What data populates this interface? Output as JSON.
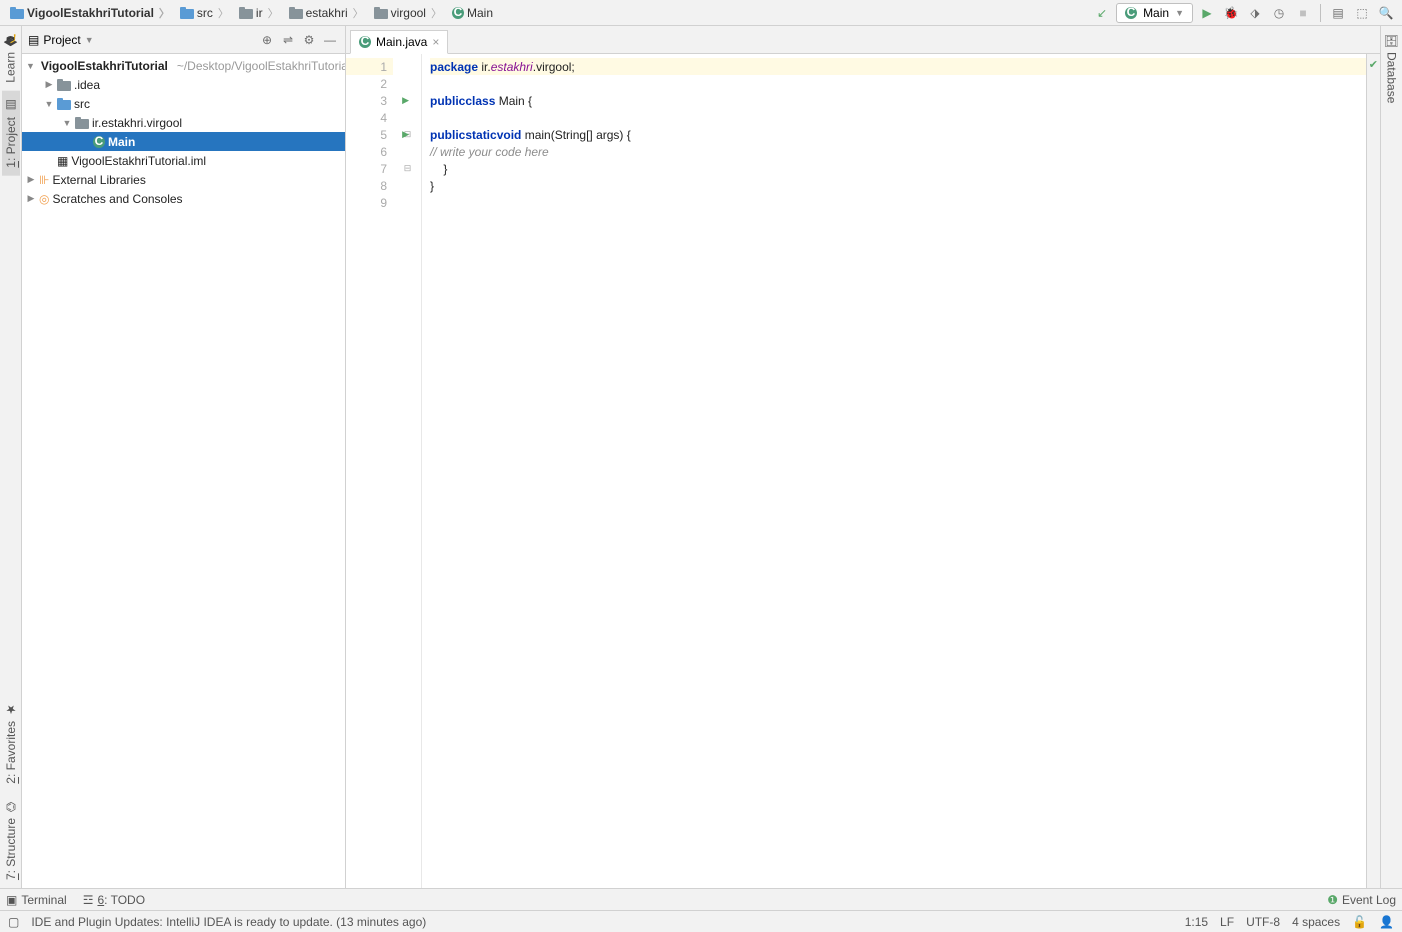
{
  "breadcrumb": [
    {
      "label": "VigoolEstakhriTutorial",
      "icon": "folder-blue",
      "bold": true
    },
    {
      "label": "src",
      "icon": "folder-blue"
    },
    {
      "label": "ir",
      "icon": "folder"
    },
    {
      "label": "estakhri",
      "icon": "folder"
    },
    {
      "label": "virgool",
      "icon": "folder"
    },
    {
      "label": "Main",
      "icon": "class"
    }
  ],
  "run_config": "Main",
  "panel": {
    "title": "Project"
  },
  "tree": {
    "root": "VigoolEstakhriTutorial",
    "root_hint": "~/Desktop/VigoolEstakhriTutorial",
    "idea": ".idea",
    "src": "src",
    "pkg": "ir.estakhri.virgool",
    "main": "Main",
    "iml": "VigoolEstakhriTutorial.iml",
    "ext": "External Libraries",
    "scratch": "Scratches and Consoles"
  },
  "tab": {
    "name": "Main.java"
  },
  "code": {
    "l1_kw": "package",
    "l1_rest": " ir.",
    "l1_pkg": "estakhri",
    "l1_rest2": ".virgool;",
    "l3_kw1": "public",
    "l3_kw2": "class",
    "l3_rest": " Main {",
    "l5_kw1": "public",
    "l5_kw2": "static",
    "l5_kw3": "void",
    "l5_rest": " main(String[] args) {",
    "l6_cm": "// write your code here",
    "l7": "    }",
    "l8": "}"
  },
  "gutter_lines": [
    "1",
    "2",
    "3",
    "4",
    "5",
    "6",
    "7",
    "8",
    "9"
  ],
  "bottom": {
    "terminal": "Terminal",
    "todo_prefix": "6",
    "todo": ": TODO",
    "event_log": "Event Log"
  },
  "status": {
    "msg_prefix": "IDE and Plugin Updates: ",
    "msg": "IntelliJ IDEA is ready to update. (13 minutes ago)",
    "pos": "1:15",
    "le": "LF",
    "enc": "UTF-8",
    "indent": "4 spaces"
  },
  "rails": {
    "learn": "Learn",
    "project_prefix": "1",
    "project": ": Project",
    "fav_prefix": "2",
    "fav": ": Favorites",
    "struct_prefix": "7",
    "struct": ": Structure",
    "db": "Database"
  }
}
